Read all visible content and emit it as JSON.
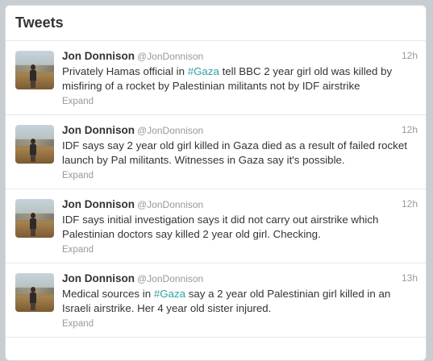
{
  "header": {
    "title": "Tweets"
  },
  "tweets": [
    {
      "fullname": "Jon Donnison",
      "username": "@JonDonnison",
      "time": "12h",
      "text_before": "Privately Hamas official in ",
      "hashtag": "#Gaza",
      "text_after": " tell BBC 2 year girl old was killed by misfiring of a rocket by Palestinian militants not by IDF airstrike",
      "expand": "Expand"
    },
    {
      "fullname": "Jon Donnison",
      "username": "@JonDonnison",
      "time": "12h",
      "text_before": "IDF says say 2 year old girl killed in Gaza died as a result of failed rocket launch by Pal militants. Witnesses in Gaza say it's possible.",
      "hashtag": "",
      "text_after": "",
      "expand": "Expand"
    },
    {
      "fullname": "Jon Donnison",
      "username": "@JonDonnison",
      "time": "12h",
      "text_before": "IDF says initial investigation says it did not carry out airstrike which Palestinian doctors say killed 2 year old girl. Checking.",
      "hashtag": "",
      "text_after": "",
      "expand": "Expand"
    },
    {
      "fullname": "Jon Donnison",
      "username": "@JonDonnison",
      "time": "13h",
      "text_before": "Medical sources in ",
      "hashtag": "#Gaza",
      "text_after": " say a 2 year old Palestinian girl killed in an Israeli airstrike. Her 4 year old sister injured.",
      "expand": "Expand"
    }
  ],
  "colors": {
    "hashtag": "#2d9fa6",
    "muted": "#999999",
    "text": "#333333"
  }
}
